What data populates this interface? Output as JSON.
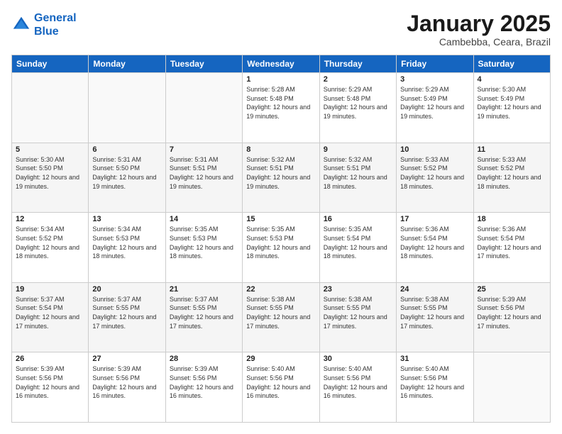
{
  "header": {
    "logo_line1": "General",
    "logo_line2": "Blue",
    "title": "January 2025",
    "location": "Cambebba, Ceara, Brazil"
  },
  "weekdays": [
    "Sunday",
    "Monday",
    "Tuesday",
    "Wednesday",
    "Thursday",
    "Friday",
    "Saturday"
  ],
  "weeks": [
    [
      {
        "day": "",
        "sunrise": "",
        "sunset": "",
        "daylight": ""
      },
      {
        "day": "",
        "sunrise": "",
        "sunset": "",
        "daylight": ""
      },
      {
        "day": "",
        "sunrise": "",
        "sunset": "",
        "daylight": ""
      },
      {
        "day": "1",
        "sunrise": "Sunrise: 5:28 AM",
        "sunset": "Sunset: 5:48 PM",
        "daylight": "Daylight: 12 hours and 19 minutes."
      },
      {
        "day": "2",
        "sunrise": "Sunrise: 5:29 AM",
        "sunset": "Sunset: 5:48 PM",
        "daylight": "Daylight: 12 hours and 19 minutes."
      },
      {
        "day": "3",
        "sunrise": "Sunrise: 5:29 AM",
        "sunset": "Sunset: 5:49 PM",
        "daylight": "Daylight: 12 hours and 19 minutes."
      },
      {
        "day": "4",
        "sunrise": "Sunrise: 5:30 AM",
        "sunset": "Sunset: 5:49 PM",
        "daylight": "Daylight: 12 hours and 19 minutes."
      }
    ],
    [
      {
        "day": "5",
        "sunrise": "Sunrise: 5:30 AM",
        "sunset": "Sunset: 5:50 PM",
        "daylight": "Daylight: 12 hours and 19 minutes."
      },
      {
        "day": "6",
        "sunrise": "Sunrise: 5:31 AM",
        "sunset": "Sunset: 5:50 PM",
        "daylight": "Daylight: 12 hours and 19 minutes."
      },
      {
        "day": "7",
        "sunrise": "Sunrise: 5:31 AM",
        "sunset": "Sunset: 5:51 PM",
        "daylight": "Daylight: 12 hours and 19 minutes."
      },
      {
        "day": "8",
        "sunrise": "Sunrise: 5:32 AM",
        "sunset": "Sunset: 5:51 PM",
        "daylight": "Daylight: 12 hours and 19 minutes."
      },
      {
        "day": "9",
        "sunrise": "Sunrise: 5:32 AM",
        "sunset": "Sunset: 5:51 PM",
        "daylight": "Daylight: 12 hours and 18 minutes."
      },
      {
        "day": "10",
        "sunrise": "Sunrise: 5:33 AM",
        "sunset": "Sunset: 5:52 PM",
        "daylight": "Daylight: 12 hours and 18 minutes."
      },
      {
        "day": "11",
        "sunrise": "Sunrise: 5:33 AM",
        "sunset": "Sunset: 5:52 PM",
        "daylight": "Daylight: 12 hours and 18 minutes."
      }
    ],
    [
      {
        "day": "12",
        "sunrise": "Sunrise: 5:34 AM",
        "sunset": "Sunset: 5:52 PM",
        "daylight": "Daylight: 12 hours and 18 minutes."
      },
      {
        "day": "13",
        "sunrise": "Sunrise: 5:34 AM",
        "sunset": "Sunset: 5:53 PM",
        "daylight": "Daylight: 12 hours and 18 minutes."
      },
      {
        "day": "14",
        "sunrise": "Sunrise: 5:35 AM",
        "sunset": "Sunset: 5:53 PM",
        "daylight": "Daylight: 12 hours and 18 minutes."
      },
      {
        "day": "15",
        "sunrise": "Sunrise: 5:35 AM",
        "sunset": "Sunset: 5:53 PM",
        "daylight": "Daylight: 12 hours and 18 minutes."
      },
      {
        "day": "16",
        "sunrise": "Sunrise: 5:35 AM",
        "sunset": "Sunset: 5:54 PM",
        "daylight": "Daylight: 12 hours and 18 minutes."
      },
      {
        "day": "17",
        "sunrise": "Sunrise: 5:36 AM",
        "sunset": "Sunset: 5:54 PM",
        "daylight": "Daylight: 12 hours and 18 minutes."
      },
      {
        "day": "18",
        "sunrise": "Sunrise: 5:36 AM",
        "sunset": "Sunset: 5:54 PM",
        "daylight": "Daylight: 12 hours and 17 minutes."
      }
    ],
    [
      {
        "day": "19",
        "sunrise": "Sunrise: 5:37 AM",
        "sunset": "Sunset: 5:54 PM",
        "daylight": "Daylight: 12 hours and 17 minutes."
      },
      {
        "day": "20",
        "sunrise": "Sunrise: 5:37 AM",
        "sunset": "Sunset: 5:55 PM",
        "daylight": "Daylight: 12 hours and 17 minutes."
      },
      {
        "day": "21",
        "sunrise": "Sunrise: 5:37 AM",
        "sunset": "Sunset: 5:55 PM",
        "daylight": "Daylight: 12 hours and 17 minutes."
      },
      {
        "day": "22",
        "sunrise": "Sunrise: 5:38 AM",
        "sunset": "Sunset: 5:55 PM",
        "daylight": "Daylight: 12 hours and 17 minutes."
      },
      {
        "day": "23",
        "sunrise": "Sunrise: 5:38 AM",
        "sunset": "Sunset: 5:55 PM",
        "daylight": "Daylight: 12 hours and 17 minutes."
      },
      {
        "day": "24",
        "sunrise": "Sunrise: 5:38 AM",
        "sunset": "Sunset: 5:55 PM",
        "daylight": "Daylight: 12 hours and 17 minutes."
      },
      {
        "day": "25",
        "sunrise": "Sunrise: 5:39 AM",
        "sunset": "Sunset: 5:56 PM",
        "daylight": "Daylight: 12 hours and 17 minutes."
      }
    ],
    [
      {
        "day": "26",
        "sunrise": "Sunrise: 5:39 AM",
        "sunset": "Sunset: 5:56 PM",
        "daylight": "Daylight: 12 hours and 16 minutes."
      },
      {
        "day": "27",
        "sunrise": "Sunrise: 5:39 AM",
        "sunset": "Sunset: 5:56 PM",
        "daylight": "Daylight: 12 hours and 16 minutes."
      },
      {
        "day": "28",
        "sunrise": "Sunrise: 5:39 AM",
        "sunset": "Sunset: 5:56 PM",
        "daylight": "Daylight: 12 hours and 16 minutes."
      },
      {
        "day": "29",
        "sunrise": "Sunrise: 5:40 AM",
        "sunset": "Sunset: 5:56 PM",
        "daylight": "Daylight: 12 hours and 16 minutes."
      },
      {
        "day": "30",
        "sunrise": "Sunrise: 5:40 AM",
        "sunset": "Sunset: 5:56 PM",
        "daylight": "Daylight: 12 hours and 16 minutes."
      },
      {
        "day": "31",
        "sunrise": "Sunrise: 5:40 AM",
        "sunset": "Sunset: 5:56 PM",
        "daylight": "Daylight: 12 hours and 16 minutes."
      },
      {
        "day": "",
        "sunrise": "",
        "sunset": "",
        "daylight": ""
      }
    ]
  ]
}
